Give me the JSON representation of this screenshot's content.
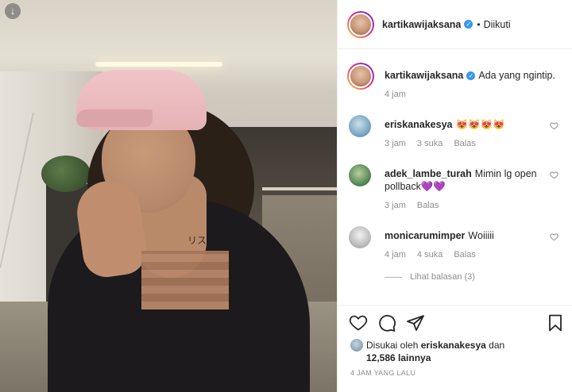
{
  "post": {
    "author": "kartikawijaksana",
    "follow_status": "Diikuti",
    "separator": "•",
    "verified_glyph": "✓",
    "caption_text": "Ada yang ngintip.",
    "caption_time": "4 jam",
    "tattoo_text": "リス"
  },
  "comments": [
    {
      "user": "eriskanakesya",
      "text": "😻😻😻😻",
      "time": "3 jam",
      "likes": "3 suka",
      "reply": "Balas",
      "avatar_color": "#7aa7c4"
    },
    {
      "user": "adek_lambe_turah",
      "text": "Mimin lg open pollback💜💜",
      "time": "3 jam",
      "likes": "",
      "reply": "Balas",
      "avatar_color": "#5c8a5a"
    },
    {
      "user": "monicarumimper",
      "text": "Woiiiii",
      "time": "4 jam",
      "likes": "4 suka",
      "reply": "Balas",
      "avatar_color": "#9a9a9a"
    }
  ],
  "view_replies": "Lihat balasan (3)",
  "liked_by": {
    "prefix": "Disukai oleh",
    "user": "eriskanakesya",
    "conjunction": "dan",
    "others": "12,586 lainnya"
  },
  "timestamp": "4 JAM YANG LALU",
  "colors": {
    "verified": "#3897f0",
    "muted": "#8e8e8e",
    "text": "#262626"
  },
  "icons": [
    "arrow-down-icon",
    "heart-icon",
    "comment-icon",
    "share-icon",
    "bookmark-icon"
  ]
}
